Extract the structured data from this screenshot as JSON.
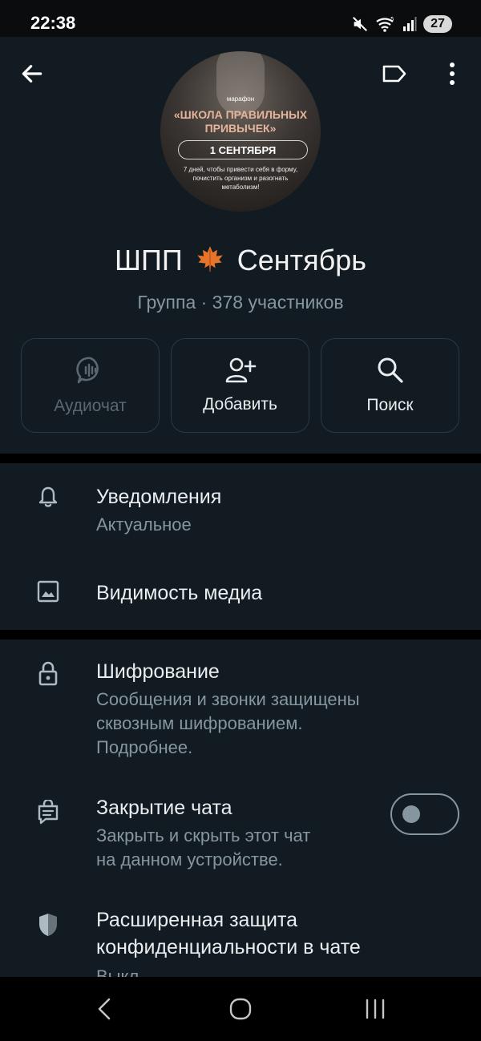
{
  "status_bar": {
    "time": "22:38",
    "battery": "27",
    "icons": [
      "mute-icon",
      "wifi-icon",
      "signal-icon",
      "battery-icon"
    ]
  },
  "header": {
    "icons": [
      "back-arrow-icon",
      "label-icon",
      "more-vert-icon"
    ],
    "avatar": {
      "kicker": "марафон",
      "title_line1": "«ШКОЛА ПРАВИЛЬНЫХ",
      "title_line2": "ПРИВЫЧЕК»",
      "date": "1 СЕНТЯБРЯ",
      "desc_line1": "7 дней, чтобы привести себя в форму,",
      "desc_line2": "почистить организм и разогнать",
      "desc_line3": "метаболизм!"
    },
    "title_part1": "ШПП",
    "title_emoji": "maple-leaf-icon",
    "title_part2": "Сентябрь",
    "subtitle": "Группа · 378 участников"
  },
  "actions": [
    {
      "label": "Аудиочат",
      "icon": "audio-chat-icon",
      "enabled": false
    },
    {
      "label": "Добавить",
      "icon": "add-person-icon",
      "enabled": true
    },
    {
      "label": "Поиск",
      "icon": "search-icon",
      "enabled": true
    }
  ],
  "settings_1": {
    "notifications": {
      "title": "Уведомления",
      "subtitle": "Актуальное",
      "icon": "bell-icon"
    },
    "media": {
      "title": "Видимость медиа",
      "icon": "image-icon"
    }
  },
  "settings_2": {
    "encryption": {
      "title": "Шифрование",
      "line1": "Сообщения и звонки защищены",
      "line2": "сквозным шифрованием.",
      "line3": "Подробнее.",
      "icon": "lock-icon"
    },
    "chat_lock": {
      "title": "Закрытие чата",
      "line1": "Закрыть и скрыть этот чат",
      "line2": "на данном устройстве.",
      "icon": "chat-lock-icon",
      "toggle_on": false
    },
    "privacy": {
      "line1": "Расширенная защита",
      "line2": "конфиденциальности в чате",
      "status": "Выкл.",
      "icon": "shield-icon"
    }
  },
  "nav_bar": {
    "icons": [
      "nav-back-icon",
      "nav-home-icon",
      "nav-recents-icon"
    ]
  },
  "colors": {
    "background": "#0b141a",
    "panel": "#111b21",
    "primary_text": "#e9edef",
    "secondary_text": "#8696a0",
    "border": "#2a3942"
  }
}
